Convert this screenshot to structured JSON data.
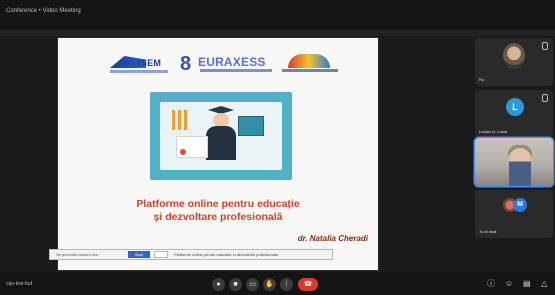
{
  "window": {
    "title": "Conference • Video Meeting"
  },
  "slide": {
    "logos": {
      "isem": "ISEM",
      "euraxess": "EURAXESS",
      "euraxess_digit": "8"
    },
    "title_line1": "Platforme online pentru educație",
    "title_line2": "și dezvoltare profesională",
    "author": "dr. Natalia Cheradi"
  },
  "share_bar": {
    "message": "Se prezintă ecranul dvs.",
    "stop_label": "Stop sharing",
    "info_text": "Platforme online pentru educatie si dezvoltare profesionala"
  },
  "participants": [
    {
      "name": "Ru",
      "avatar_type": "photo"
    },
    {
      "name": "Lucian G. Lucia",
      "avatar_type": "initial",
      "initial": "L",
      "avatar_color": "#2a9bd8"
    },
    {
      "name": "",
      "avatar_type": "video",
      "active": true
    },
    {
      "name": "Tu și încă",
      "avatar_type": "duo",
      "initial": "M"
    }
  ],
  "bottom_bar": {
    "meeting_code": "cqo-kxe-fud",
    "controls": [
      "mic-icon",
      "camera-icon",
      "captions-icon",
      "raise-hand-icon",
      "more-icon",
      "hangup-icon"
    ],
    "right_controls": [
      "info-icon",
      "people-icon",
      "chat-icon",
      "activities-icon"
    ]
  },
  "colors": {
    "accent": "#4a8cf0",
    "hangup": "#e0382c",
    "slide_title": "#d3432b"
  }
}
